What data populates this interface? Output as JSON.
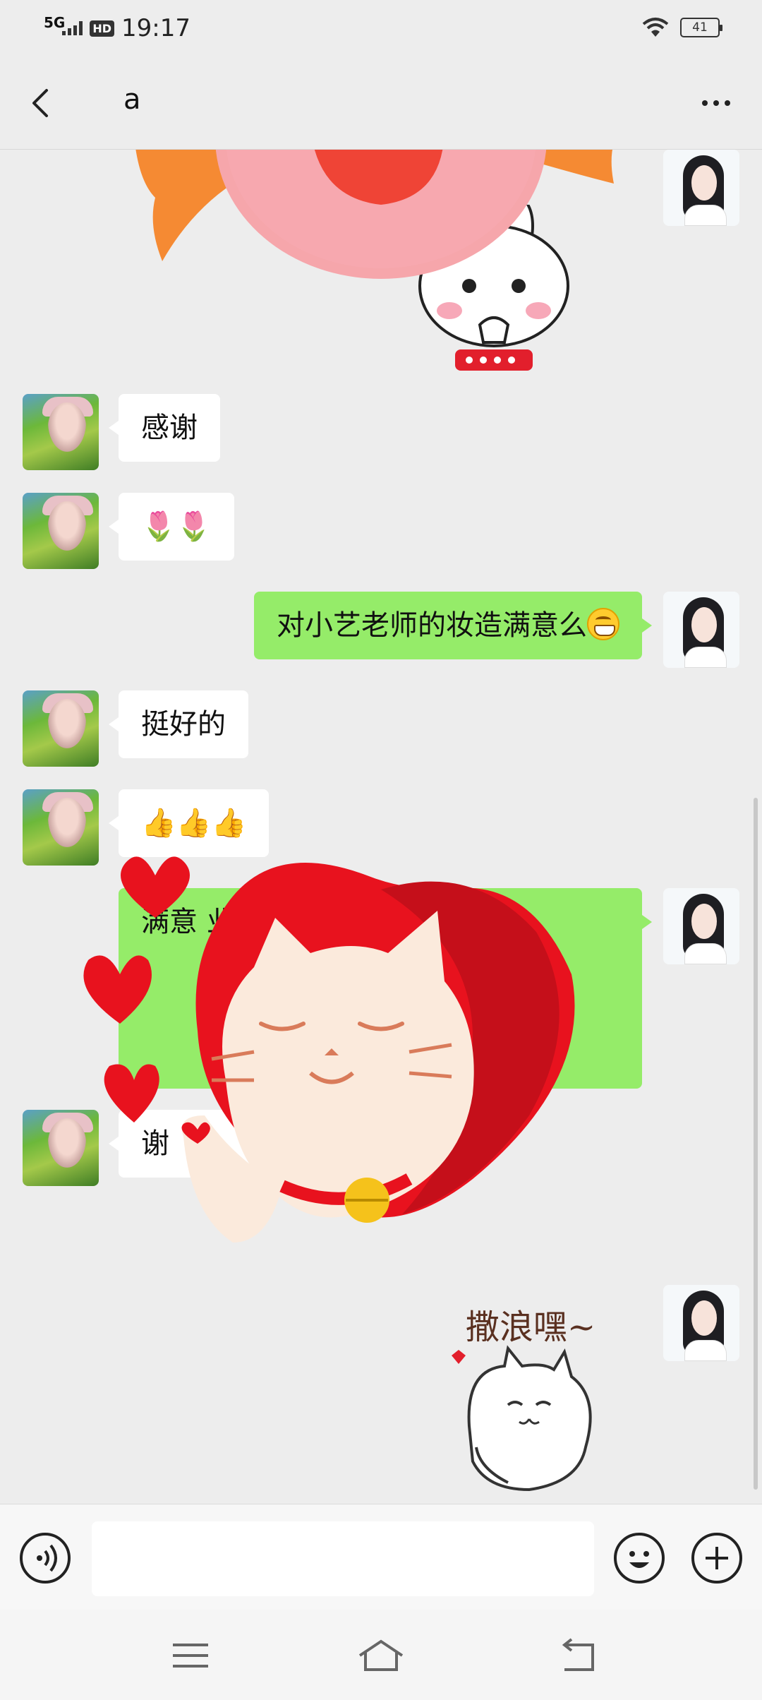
{
  "status_bar": {
    "network": "5G",
    "hd_badge": "HD",
    "time": "19:17",
    "battery": "41"
  },
  "header": {
    "title": "a"
  },
  "messages": [
    {
      "sender": "friend",
      "text": "感谢"
    },
    {
      "sender": "friend",
      "text": "🌷🌷"
    },
    {
      "sender": "self",
      "text": "对小艺老师的妆造满意么"
    },
    {
      "sender": "friend",
      "text": "挺好的"
    },
    {
      "sender": "friend",
      "text": "👍👍👍"
    },
    {
      "sender": "self",
      "text": "满意 业素 顺心"
    },
    {
      "sender": "friend",
      "text": "谢"
    }
  ],
  "stickers": {
    "cat_sticker_caption": "撒浪嘿~"
  },
  "input": {
    "placeholder": ""
  },
  "colors": {
    "background": "#ededed",
    "bubble_self": "#95ec69",
    "bubble_friend": "#ffffff"
  },
  "icons": [
    "back-arrow-icon",
    "more-dots-icon",
    "voice-icon",
    "emoji-icon",
    "plus-icon",
    "menu-icon",
    "home-icon",
    "return-icon"
  ]
}
